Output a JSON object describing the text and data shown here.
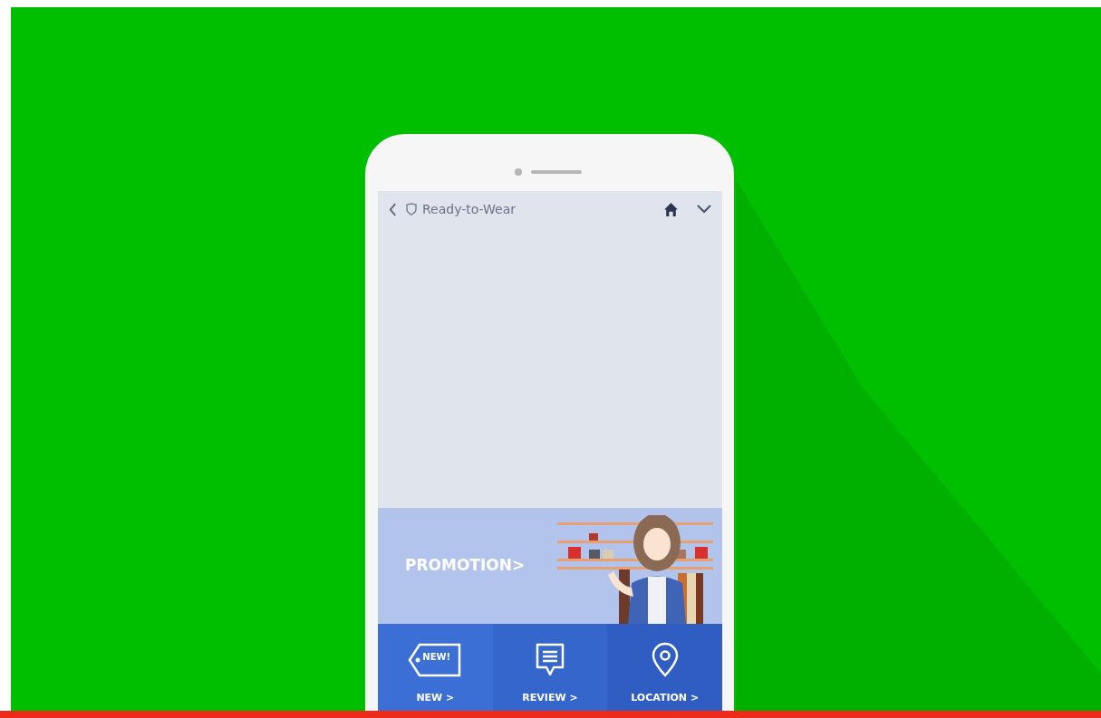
{
  "header": {
    "title": "Ready-to-Wear"
  },
  "promotion": {
    "label": "PROMOTION>"
  },
  "tiles": [
    {
      "kind": "tag",
      "label": "NEW >",
      "tag_text": "NEW!"
    },
    {
      "kind": "review",
      "label": "REVIEW >"
    },
    {
      "kind": "location",
      "label": "LOCATION >"
    }
  ]
}
